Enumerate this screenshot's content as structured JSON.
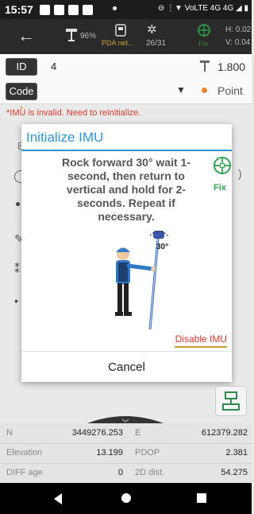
{
  "status_bar": {
    "time": "15:57",
    "right_text": "⊖ ⋮▼ VoLTE 4G 4G ◢ ▮"
  },
  "app_bar": {
    "battery_percent": "96%",
    "device_label": "PDA net...",
    "satellites": "26/31",
    "fix_status": "Fix",
    "h_value": "H: 0.02",
    "v_value": "V: 0.04"
  },
  "point_form": {
    "id_label": "ID",
    "id_value": "4",
    "code_label": "Code",
    "antenna_height": "1.800",
    "point_type": "Point"
  },
  "warning": "*IMU is invalid. Need to reinitialize.",
  "dialog": {
    "title": "Initialize IMU",
    "message": "Rock forward 30° wait 1-second, then return to vertical and hold for 2-seconds. Repeat if necessary.",
    "fix_label": "Fix",
    "angle_label": "30°",
    "disable_label": "Disable IMU",
    "cancel_label": "Cancel"
  },
  "data_rows": [
    {
      "label": "N",
      "value": "3449276.253",
      "label2": "E",
      "value2": "612379.282"
    },
    {
      "label": "Elevation",
      "value": "13.199",
      "label2": "PDOP",
      "value2": "2.381"
    },
    {
      "label": "DIFF age",
      "value": "0",
      "label2": "2D dist.",
      "value2": "54.275"
    }
  ],
  "colors": {
    "accent": "#2f95d6",
    "warning": "#d43a2a",
    "fix_green": "#2da44e"
  }
}
